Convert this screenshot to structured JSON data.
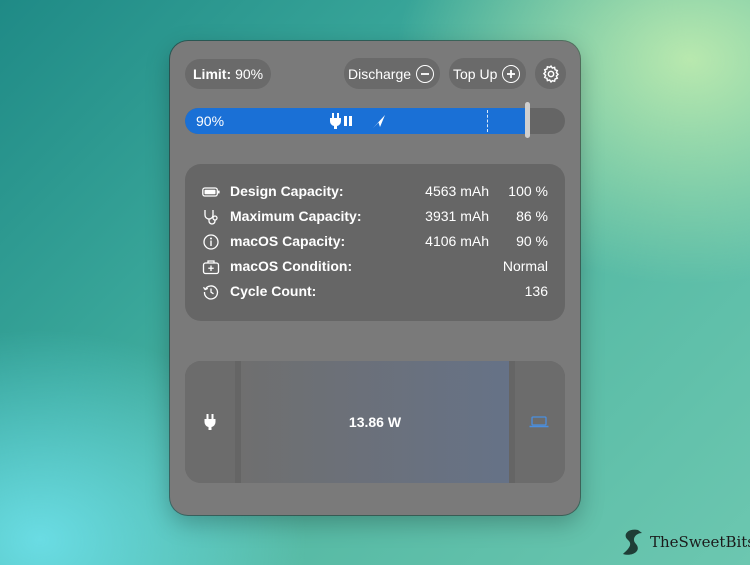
{
  "header": {
    "limit_label": "Limit:",
    "limit_value": "90%",
    "discharge_label": "Discharge",
    "topup_label": "Top Up"
  },
  "charge_bar": {
    "label": "90%",
    "level": 0.9
  },
  "battery_info": {
    "rows": [
      {
        "icon": "battery-icon",
        "label": "Design Capacity:",
        "value": "4563 mAh",
        "percent": "100 %"
      },
      {
        "icon": "stethoscope-icon",
        "label": "Maximum Capacity:",
        "value": "3931 mAh",
        "percent": "86 %"
      },
      {
        "icon": "info-icon",
        "label": "macOS Capacity:",
        "value": "4106 mAh",
        "percent": "90 %"
      },
      {
        "icon": "medical-kit-icon",
        "label": "macOS Condition:",
        "value": "Normal",
        "percent": ""
      },
      {
        "icon": "history-icon",
        "label": "Cycle Count:",
        "value": "136",
        "percent": ""
      }
    ]
  },
  "power_flow": {
    "wattage": "13.86 W",
    "source_icon": "plug-icon",
    "target_icon": "laptop-icon",
    "accent": "#4a8fe0"
  },
  "watermark": {
    "text": "TheSweetBits"
  },
  "colors": {
    "accent": "#1a70d6",
    "panel": "#7a7a7a",
    "card": "#666666"
  }
}
